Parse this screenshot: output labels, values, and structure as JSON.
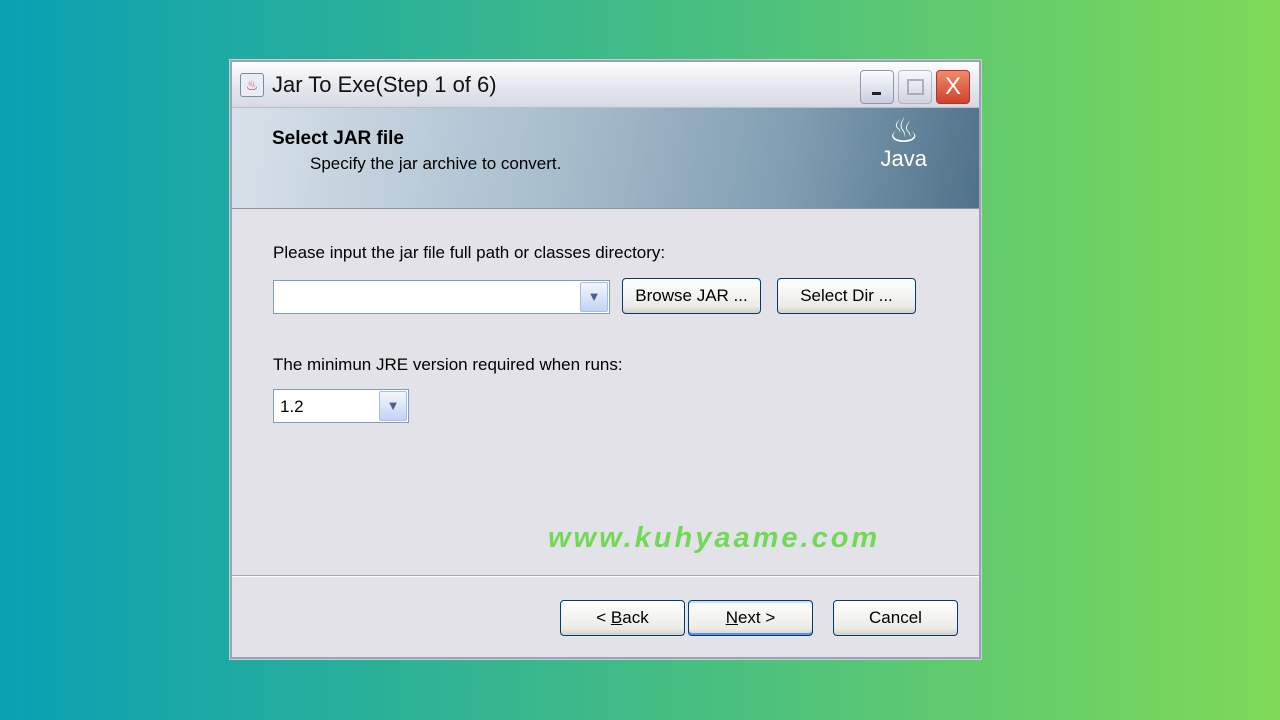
{
  "window": {
    "title": "Jar To Exe(Step 1 of 6)",
    "close_glyph": "X"
  },
  "banner": {
    "heading": "Select JAR file",
    "subheading": "Specify the jar archive to convert.",
    "logo_text": "Java"
  },
  "form": {
    "jar_label": "Please input the jar file full path or classes directory:",
    "jar_value": "",
    "browse_label": "Browse JAR ...",
    "select_dir_label": "Select Dir ...",
    "jre_label": "The minimun JRE version required when runs:",
    "jre_value": "1.2"
  },
  "watermark": "www.kuhyaame.com",
  "footer": {
    "back_prefix": "< ",
    "back_mnemonic": "B",
    "back_rest": "ack",
    "next_mnemonic": "N",
    "next_rest": "ext >",
    "cancel_label": "Cancel"
  }
}
